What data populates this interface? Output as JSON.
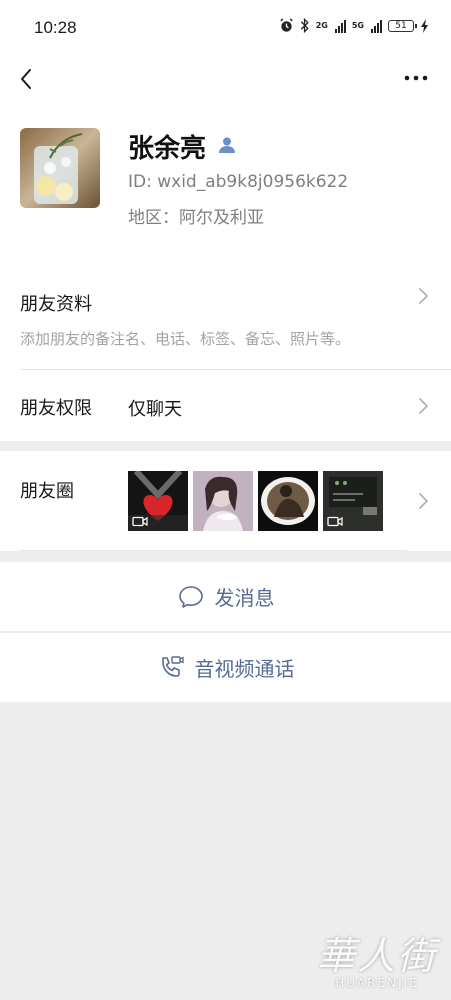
{
  "status_bar": {
    "time": "10:28",
    "net1": "2G",
    "net2": "5G",
    "battery": "51",
    "icons": [
      "alarm-icon",
      "bluetooth-icon",
      "signal-icon",
      "signal-icon",
      "battery-icon",
      "charging-icon"
    ]
  },
  "topbar": {
    "back_icon": "chevron-left-icon",
    "more_icon": "more-dots-icon"
  },
  "profile": {
    "name": "张余亮",
    "wechat_id": "ID:  wxid_ab9k8j0956k622",
    "region": "地区：阿尔及利亚",
    "badge_icon": "person-icon",
    "badge_color": "#6c8fc7"
  },
  "friend_info": {
    "title": "朋友资料",
    "hint": "添加朋友的备注名、电话、标签、备忘、照片等。"
  },
  "friend_permission": {
    "title": "朋友权限",
    "value": "仅聊天"
  },
  "moments": {
    "title": "朋友圈",
    "thumbnails": [
      {
        "desc": "heart-hands",
        "video": true
      },
      {
        "desc": "woman-portrait",
        "video": false
      },
      {
        "desc": "person-sitting",
        "video": false
      },
      {
        "desc": "dark-screen",
        "video": true
      }
    ]
  },
  "actions": {
    "send_message": "发消息",
    "video_call": "音视频通话",
    "accent_color": "#576b95"
  },
  "watermark": {
    "chinese": "華人街",
    "english": "HUARENJIE"
  }
}
